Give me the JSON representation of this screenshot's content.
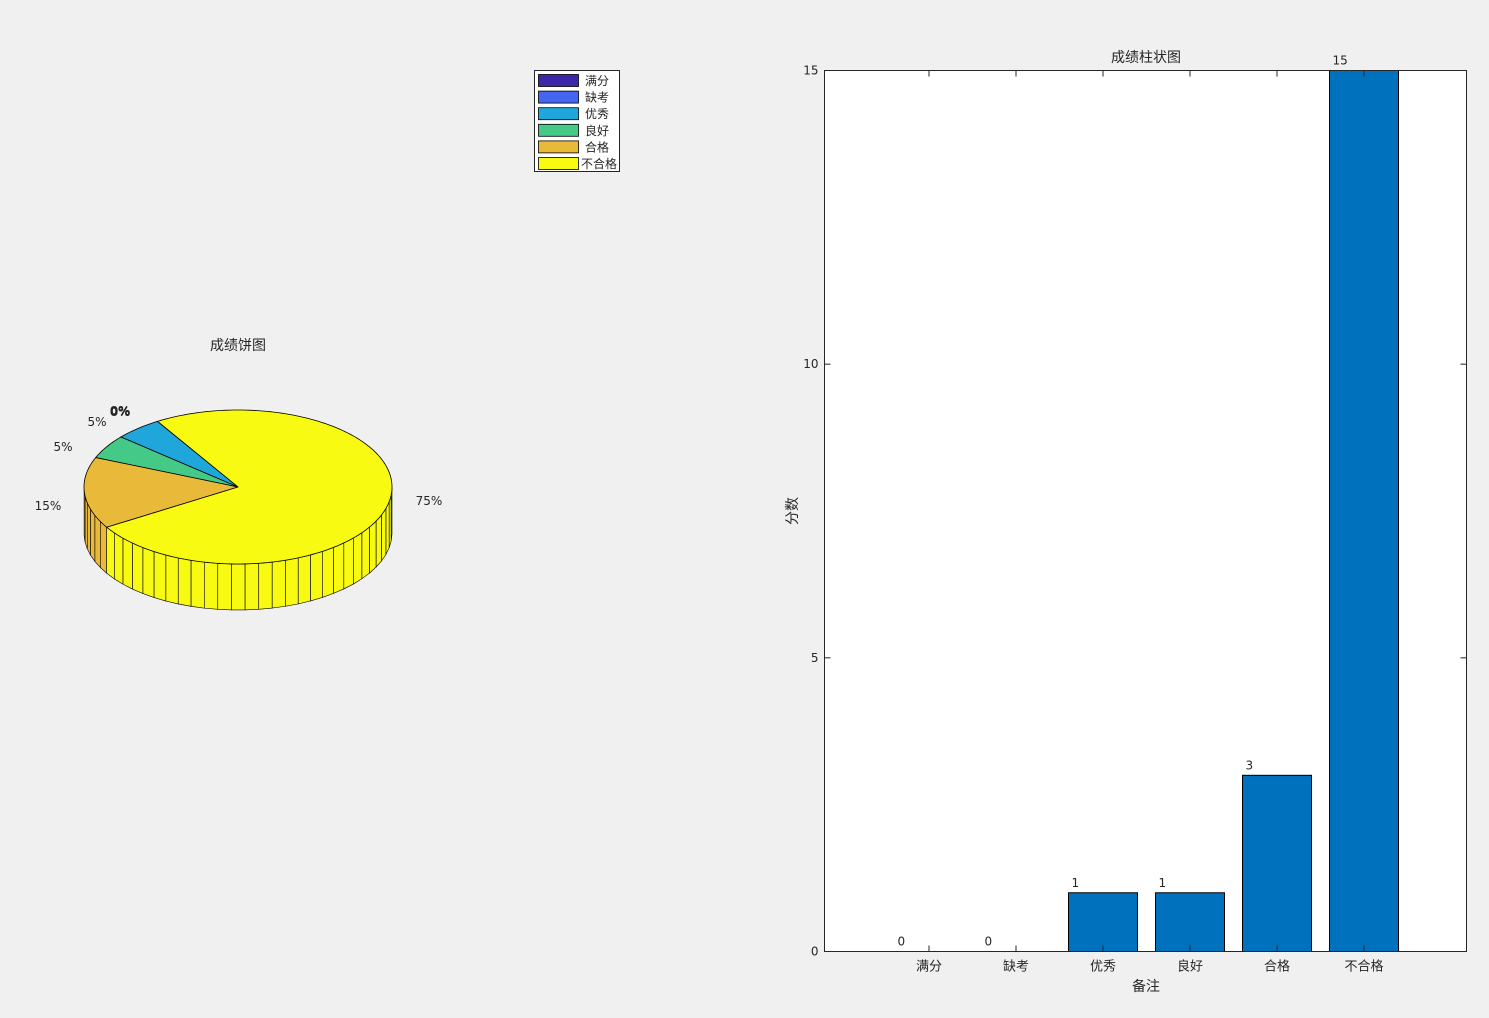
{
  "chart_data": [
    {
      "type": "pie",
      "style": "3d",
      "title": "成绩饼图",
      "legend_position": "top-right",
      "slices": [
        {
          "label": "满分",
          "value": 0,
          "percent_label": "0%",
          "color": "#3e26a8"
        },
        {
          "label": "缺考",
          "value": 0,
          "percent_label": "0%",
          "color": "#4465f0"
        },
        {
          "label": "优秀",
          "value": 1,
          "percent_label": "5%",
          "color": "#1fa7dc"
        },
        {
          "label": "良好",
          "value": 1,
          "percent_label": "5%",
          "color": "#45c987"
        },
        {
          "label": "合格",
          "value": 3,
          "percent_label": "15%",
          "color": "#e9b93a"
        },
        {
          "label": "不合格",
          "value": 15,
          "percent_label": "75%",
          "color": "#f8fa12"
        }
      ]
    },
    {
      "type": "bar",
      "title": "成绩柱状图",
      "xlabel": "备注",
      "ylabel": "分数",
      "categories": [
        "满分",
        "缺考",
        "优秀",
        "良好",
        "合格",
        "不合格"
      ],
      "values": [
        0,
        0,
        1,
        1,
        3,
        15
      ],
      "ylim": [
        0,
        15
      ],
      "yticks": [
        0,
        5,
        10,
        15
      ],
      "bar_color": "#0072bd",
      "grid": false
    }
  ]
}
